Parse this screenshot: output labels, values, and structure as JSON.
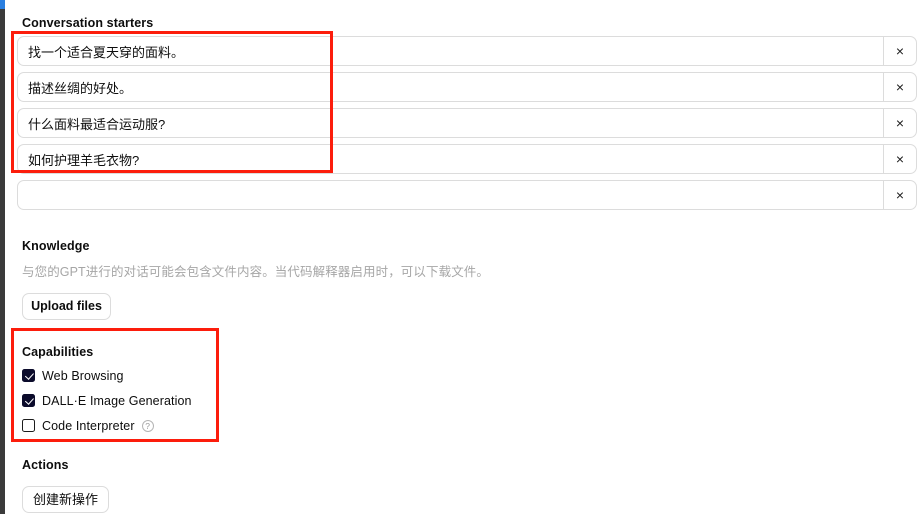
{
  "window": {
    "accent_color": "#2a7fe0",
    "edge_color": "#3b3b3b"
  },
  "annotations": {
    "color": "#fc1d0c",
    "boxes": [
      {
        "name": "conversation-starters-highlight"
      },
      {
        "name": "capabilities-highlight"
      }
    ]
  },
  "conversation_starters": {
    "label": "Conversation starters",
    "clear_icon": "×",
    "rows": [
      {
        "value": "找一个适合夏天穿的面料。",
        "placeholder": ""
      },
      {
        "value": "描述丝绸的好处。",
        "placeholder": ""
      },
      {
        "value": "什么面料最适合运动服?",
        "placeholder": ""
      },
      {
        "value": "如何护理羊毛衣物?",
        "placeholder": ""
      },
      {
        "value": "",
        "placeholder": ""
      }
    ]
  },
  "knowledge": {
    "label": "Knowledge",
    "description": "与您的GPT进行的对话可能会包含文件内容。当代码解释器启用时，可以下载文件。",
    "upload_button": "Upload files"
  },
  "capabilities": {
    "label": "Capabilities",
    "items": [
      {
        "label": "Web Browsing",
        "checked": true,
        "help": false
      },
      {
        "label": "DALL·E Image Generation",
        "checked": true,
        "help": false
      },
      {
        "label": "Code Interpreter",
        "checked": false,
        "help": true,
        "help_icon": "?"
      }
    ]
  },
  "actions": {
    "label": "Actions",
    "create_button": "创建新操作"
  }
}
